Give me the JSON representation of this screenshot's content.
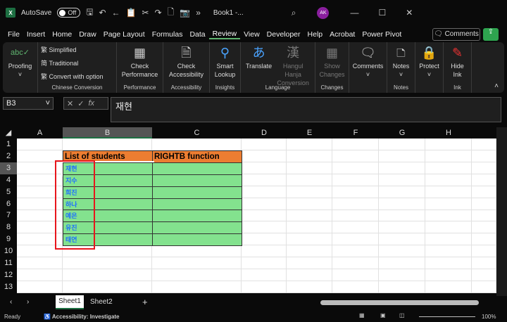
{
  "titlebar": {
    "autosave": "AutoSave",
    "toggle": "Off",
    "title": "Book1 -...",
    "avatar": "AK"
  },
  "menu": [
    "File",
    "Insert",
    "Home",
    "Draw",
    "Page Layout",
    "Formulas",
    "Data",
    "Review",
    "View",
    "Developer",
    "Help",
    "Acrobat",
    "Power Pivot"
  ],
  "menu_active": "Review",
  "comments_btn": "Comments",
  "ribbon": {
    "proofing": "Proofing",
    "simplified": "Simplified",
    "traditional": "Traditional",
    "convert": "Convert with option",
    "chinese": "Chinese Conversion",
    "check_perf": "Check",
    "check_perf2": "Performance",
    "perf": "Performance",
    "check_acc": "Check",
    "check_acc2": "Accessibility",
    "acc": "Accessibility",
    "smart": "Smart",
    "lookup": "Lookup",
    "insights": "Insights",
    "translate": "Translate",
    "hangul": "Hangul Hanja",
    "conversion": "Conversion",
    "language": "Language",
    "show": "Show",
    "changes_btn": "Changes",
    "changes": "Changes",
    "comments": "Comments",
    "notes_btn": "Notes",
    "notes": "Notes",
    "protect": "Protect",
    "hide": "Hide",
    "ink_btn": "Ink",
    "ink": "Ink"
  },
  "formula": {
    "namebox": "B3",
    "fx": "fx",
    "value": "재현"
  },
  "columns": [
    "A",
    "B",
    "C",
    "D",
    "E",
    "F",
    "G",
    "H"
  ],
  "rows": [
    "1",
    "2",
    "3",
    "4",
    "5",
    "6",
    "7",
    "8",
    "9",
    "10",
    "11",
    "12",
    "13"
  ],
  "table": {
    "headers": [
      "List of students",
      "RIGHTB function"
    ],
    "students": [
      "재현",
      "지수",
      "희진",
      "하나",
      "예은",
      "유진",
      "태연"
    ]
  },
  "sheets": [
    "Sheet1",
    "Sheet2"
  ],
  "status": {
    "ready": "Ready",
    "accessibility": "Accessibility: Investigate",
    "zoom": "100%"
  },
  "colors": {
    "header": "#ed7d31",
    "cells": "#83e28e",
    "text": "#1e6fff",
    "highlight": "#e8151c"
  }
}
